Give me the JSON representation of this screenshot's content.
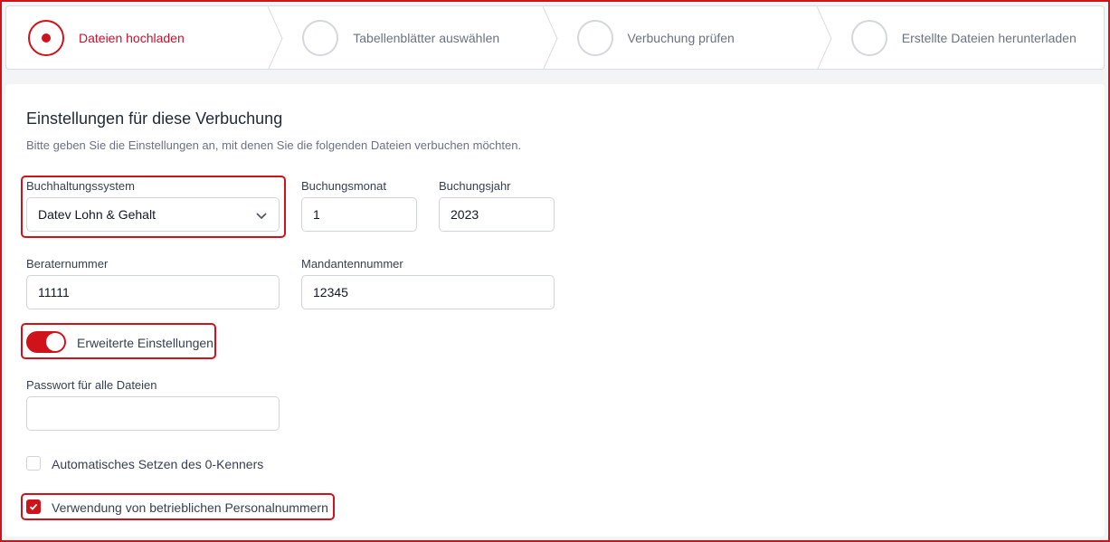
{
  "stepper": {
    "steps": [
      {
        "label": "Dateien hochladen",
        "active": true
      },
      {
        "label": "Tabellenblätter auswählen",
        "active": false
      },
      {
        "label": "Verbuchung prüfen",
        "active": false
      },
      {
        "label": "Erstellte Dateien herunterladen",
        "active": false
      }
    ]
  },
  "settings": {
    "title": "Einstellungen für diese Verbuchung",
    "subtitle": "Bitte geben Sie die Einstellungen an, mit denen Sie die folgenden Dateien verbuchen möchten.",
    "accounting_system": {
      "label": "Buchhaltungssystem",
      "value": "Datev Lohn & Gehalt"
    },
    "booking_month": {
      "label": "Buchungsmonat",
      "value": "1"
    },
    "booking_year": {
      "label": "Buchungsjahr",
      "value": "2023"
    },
    "consultant_number": {
      "label": "Beraternummer",
      "value": "11111"
    },
    "client_number": {
      "label": "Mandantennummer",
      "value": "12345"
    },
    "advanced_toggle": {
      "label": "Erweiterte Einstellungen",
      "on": true
    },
    "password": {
      "label": "Passwort für alle Dateien",
      "value": ""
    },
    "auto_zero_flag": {
      "label": "Automatisches Setzen des 0-Kenners",
      "checked": false
    },
    "company_personnel_numbers": {
      "label": "Verwendung von betrieblichen Personalnummern",
      "checked": true
    }
  },
  "colors": {
    "accent": "#d0121b",
    "border": "#d1d5db"
  }
}
